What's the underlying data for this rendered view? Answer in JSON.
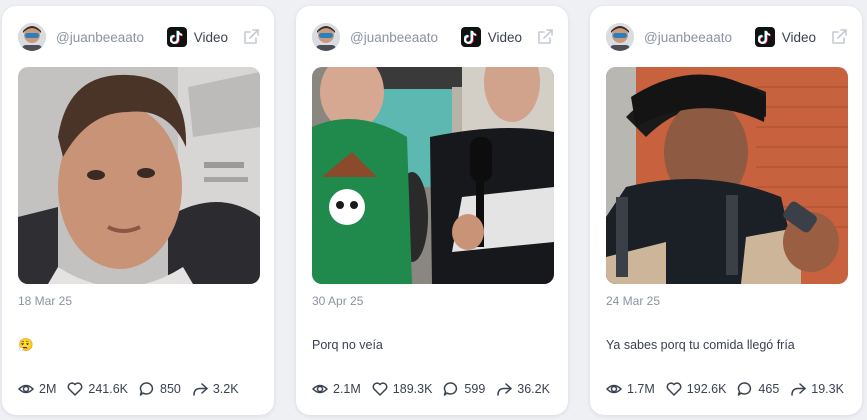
{
  "posts": [
    {
      "username": "@juanbeeaato",
      "type_label": "Video",
      "date": "18 Mar 25",
      "caption": "😮‍💨",
      "stats": {
        "views": "2M",
        "likes": "241.6K",
        "comments": "850",
        "shares": "3.2K"
      }
    },
    {
      "username": "@juanbeeaato",
      "type_label": "Video",
      "date": "30 Apr 25",
      "caption": "Porq no veía",
      "stats": {
        "views": "2.1M",
        "likes": "189.3K",
        "comments": "599",
        "shares": "36.2K"
      }
    },
    {
      "username": "@juanbeeaato",
      "type_label": "Video",
      "date": "24 Mar 25",
      "caption": "Ya sabes porq tu comida llegó fría",
      "stats": {
        "views": "1.7M",
        "likes": "192.6K",
        "comments": "465",
        "shares": "19.3K"
      }
    }
  ],
  "icons": {
    "views": "eye-icon",
    "likes": "heart-icon",
    "comments": "comment-icon",
    "shares": "share-icon",
    "platform": "tiktok-icon",
    "open": "external-link-icon"
  },
  "colors": {
    "background": "#eef0f4",
    "card": "#ffffff",
    "muted_text": "#8a93a3",
    "text": "#3a4150"
  }
}
